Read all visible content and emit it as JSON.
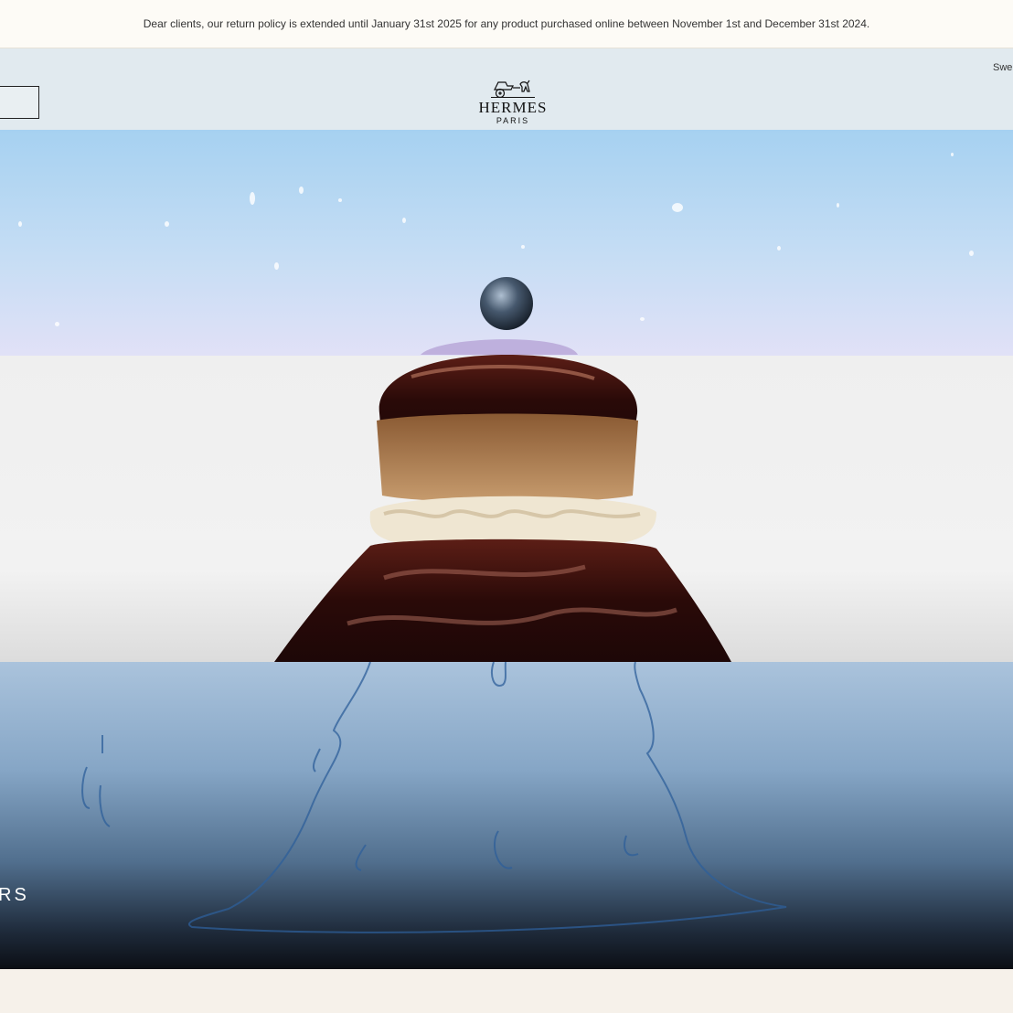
{
  "banner": {
    "text": "Dear clients, our return policy is extended until January 31st 2025 for any product purchased online between November 1st and December 31st 2024."
  },
  "header": {
    "logo_brand": "HERMES",
    "logo_city": "PARIS",
    "locale": "Swe"
  },
  "hero": {
    "caption": "RS",
    "image": "pastry-with-pearl-in-sky-and-ocean-collage"
  },
  "icons": {
    "logo": "carriage-logo-icon"
  }
}
